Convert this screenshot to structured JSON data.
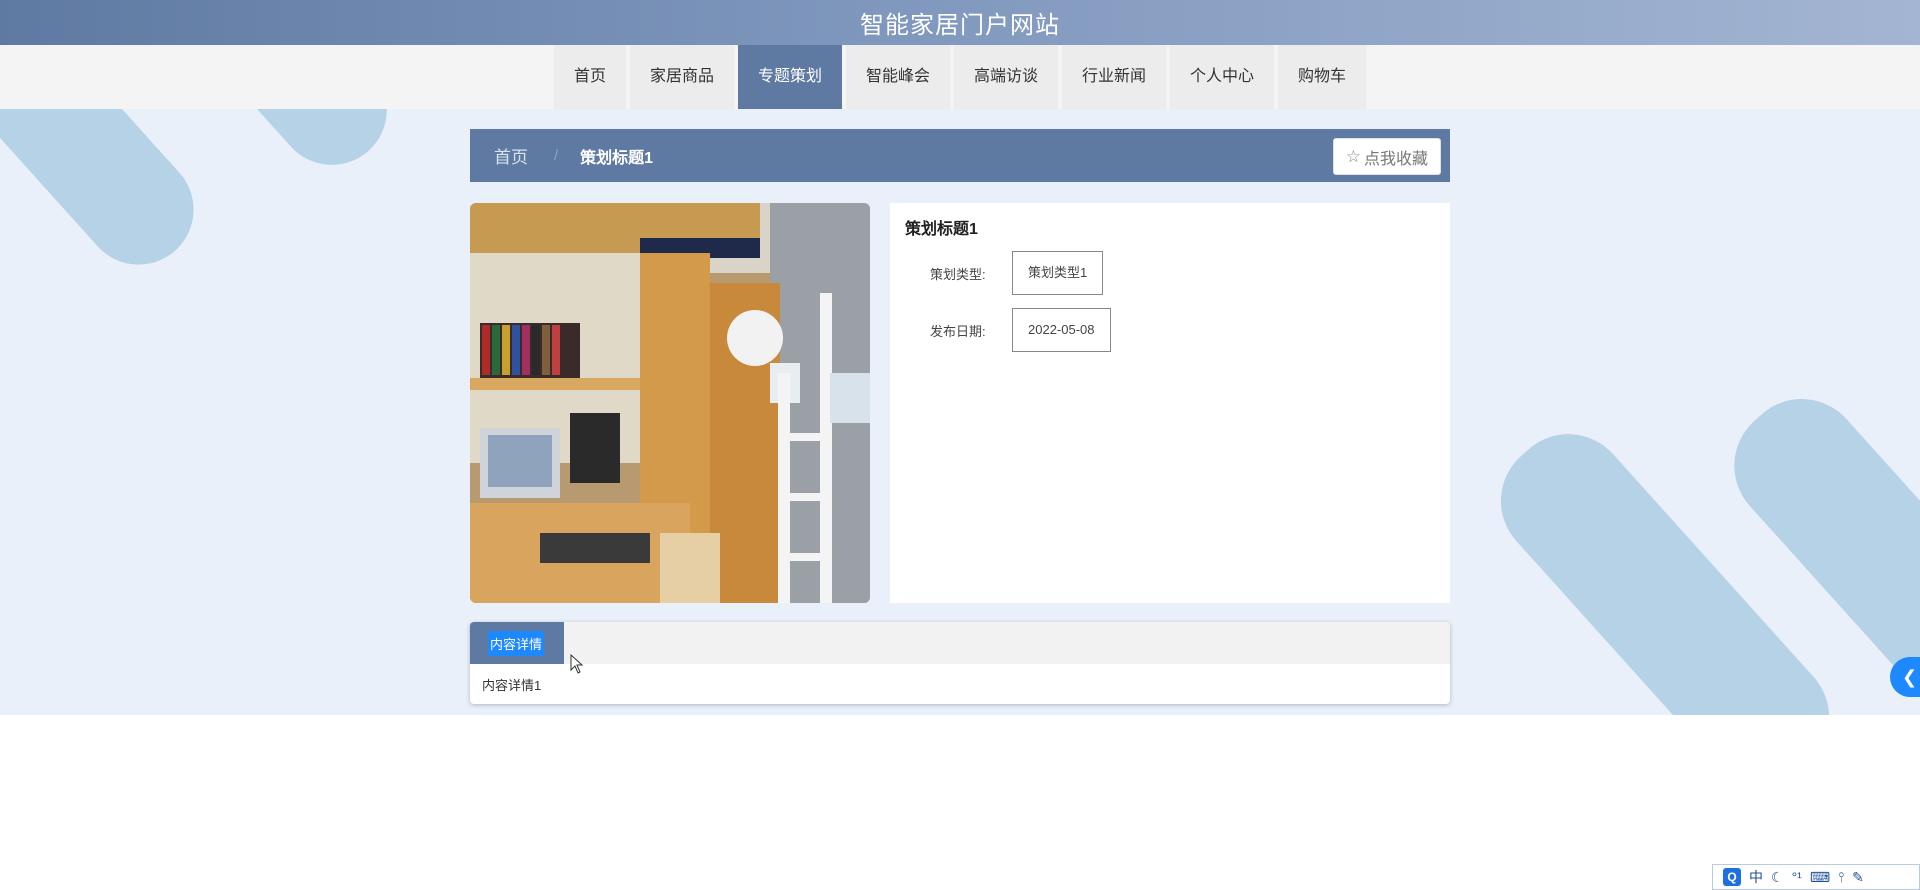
{
  "site": {
    "title": "智能家居门户网站"
  },
  "nav": {
    "items": [
      {
        "label": "首页"
      },
      {
        "label": "家居商品"
      },
      {
        "label": "专题策划"
      },
      {
        "label": "智能峰会"
      },
      {
        "label": "高端访谈"
      },
      {
        "label": "行业新闻"
      },
      {
        "label": "个人中心"
      },
      {
        "label": "购物车"
      }
    ],
    "active_index": 2
  },
  "breadcrumb": {
    "home": "首页",
    "separator": "/",
    "current": "策划标题1",
    "favorite_label": "点我收藏"
  },
  "detail": {
    "title": "策划标题1",
    "type_label": "策划类型:",
    "type_value": "策划类型1",
    "date_label": "发布日期:",
    "date_value": "2022-05-08"
  },
  "content": {
    "tab_label": "内容详情",
    "text": "内容详情1"
  },
  "ime": {
    "logo": "Q",
    "lang": "中",
    "items": [
      "☾",
      "°¹",
      "⌨",
      "⫯",
      "✎"
    ]
  },
  "colors": {
    "primary": "#5f7aa2",
    "accent": "#1e88ff",
    "content_bg": "#e9f0f9",
    "deco": "#b6d2e6"
  }
}
